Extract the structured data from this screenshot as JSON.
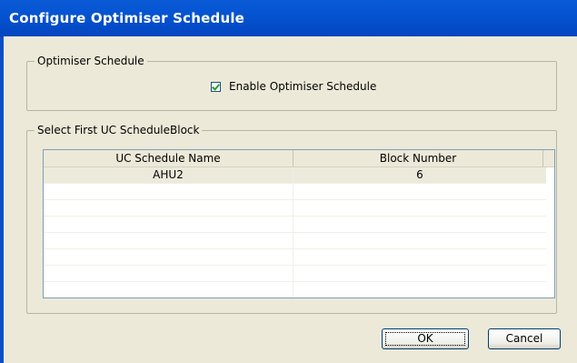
{
  "window": {
    "title": "Configure Optimiser Schedule"
  },
  "optimiser_group": {
    "legend": "Optimiser Schedule",
    "enable_label": "Enable Optimiser Schedule",
    "enable_checked": true
  },
  "block_group": {
    "legend": "Select First UC ScheduleBlock",
    "columns": [
      "UC Schedule Name",
      "Block Number"
    ],
    "rows": [
      {
        "name": "AHU2",
        "block": "6"
      }
    ]
  },
  "buttons": {
    "ok_label": "OK",
    "cancel_label": "Cancel"
  },
  "colors": {
    "title_bar": "#0553d1",
    "dialog_bg": "#ece9d8",
    "selected_row": "#eceadb"
  }
}
